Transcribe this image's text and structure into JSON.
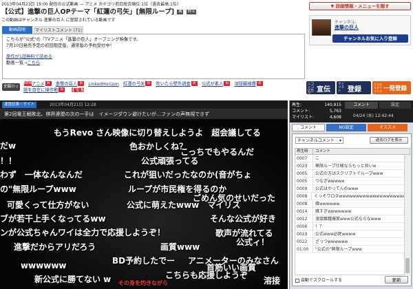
{
  "header": {
    "meta": "2013年04月23日 15:00 配信の公式動画 ― アニメ カテゴリ前日総合順位:1位（過去最高:1位）",
    "title": "【公式】進撃の巨人OPテーマ「紅蓮の弓矢」[無限ループ]",
    "subline": "この動画はチャンネル 進撃の巨人 に登録されている動画です",
    "details_btn": "▼ 詳細情報・メニューを隠す"
  },
  "channel": {
    "label": "チャンネル:",
    "name": "進撃の巨人",
    "fav": "チャンネルお気に入り登録"
  },
  "desc_tabs": [
    "動画説明",
    "マイリストコメント (71)"
  ],
  "description": [
    "こちらが\"公式\"の『TVアニメ「進撃の巨人」オープニング映像です。",
    "7月10日発売予定の初回限定版、通常版の予約受付中！"
  ],
  "desc_link": "原作が1話無料で読める",
  "desc_list_prefix": "動画一覧",
  "desc_list_link": "こちら",
  "tag_lock": "全編ロック",
  "tags": [
    "アニメ",
    "進撃の巨人",
    "LinkedHorizon",
    "紅蓮の弓矢",
    "吹いたら壁外調査",
    "公式が素人",
    "溶接職様爆",
    "鎧を自在に操作動",
    "【編集】"
  ],
  "actions": [
    "宣伝",
    "登録",
    "一発登録"
  ],
  "action_prefix": [
    "ニコニコ広告で",
    "マイリスト",
    "とりあえずマイリスト"
  ],
  "player": {
    "news_tag": "運営記事・サイト",
    "news_date": "2013年04月21日 12:28",
    "news_text": "第2回電王戦敗北、棋界連盟の次の一手は　イメージダウン避けたいが…ファンの声無視できず",
    "comments": [
      "もうRevo さん映像に切り替えしようよ　超会議してる",
      "だw",
      "色おかしくね？",
      "こっちでもやるんだ",
      "！！",
      "公式頑張ってる",
      "わず　一体なんなんだ",
      "これが狙いだったなのか(音がちょ",
      "の\"無限ループwww",
      "ループが市民権を得るのか",
      "ごめん気のせいだった",
      "可愛くって仕方がない",
      "公式に萌えたwww　マイリス",
      "ブが若干上手くなってるww",
      "そんな公式が好き",
      "ンが公式ちゃんワイは全力で応援しようぞ！",
      "歌声が流れてる",
      "公式ィ！",
      "進撃だからアリだろう",
      "画質www",
      "BD予約したでー",
      "アニメーターのみなさん",
      "wwwwww",
      "首筋いい画質",
      "こちらも応援しようぞ",
      "新公式に勝てない w",
      "溶接",
      "その身を灼きながら"
    ]
  },
  "panel": {
    "stats": [
      {
        "k": "再生:",
        "v": "140,915"
      },
      {
        "k": "コメント:",
        "v": "5,763"
      },
      {
        "k": "マイリスト:",
        "v": "4,608"
      }
    ],
    "top_tabs": [
      "コメント",
      "設定"
    ],
    "date": "04/24 (水) 12:42:44",
    "sub_tabs": [
      "コメント",
      "NG設定",
      "オススメ"
    ],
    "select": "チャンネルコメント",
    "past_btn": "過去ログを表示",
    "col_num": "再生時",
    "col_comment": "コメント",
    "rows": [
      {
        "n": "0007",
        "c": "こ"
      },
      {
        "n": "0023",
        "c": "無限ループ仕様ならもっと良いw"
      },
      {
        "n": "0005",
        "c": "公式の方はスクリプトでループwww"
      },
      {
        "n": "0005",
        "c": "つなぎwwwww"
      },
      {
        "n": "0009",
        "c": "公式はやってんのwww"
      },
      {
        "n": "0008",
        "c": "くっそワロタwwwwwwwwwwwwwwwwwwwwwww"
      },
      {
        "n": "0008",
        "c": "雑wwwwww"
      },
      {
        "n": "0014",
        "c": "雑すぎwwwwwww"
      },
      {
        "n": "0012",
        "c": "溶接職種爆笑www公式ならなwww"
      },
      {
        "n": "0006",
        "c": "！？"
      },
      {
        "n": "0013",
        "c": "公式www必死wwww"
      },
      {
        "n": "0022",
        "c": "ざっつwwwwww"
      },
      {
        "n": "01:00",
        "c": "\"公式の\"無限ループwww"
      }
    ],
    "autoscroll": "自動でスクロールする",
    "refresh": "更新"
  },
  "colors": {
    "accent": "#e8631a",
    "blue_btn": "#1c3d8c",
    "player_bg": "#000",
    "tab_active": "#2a6fc9"
  }
}
